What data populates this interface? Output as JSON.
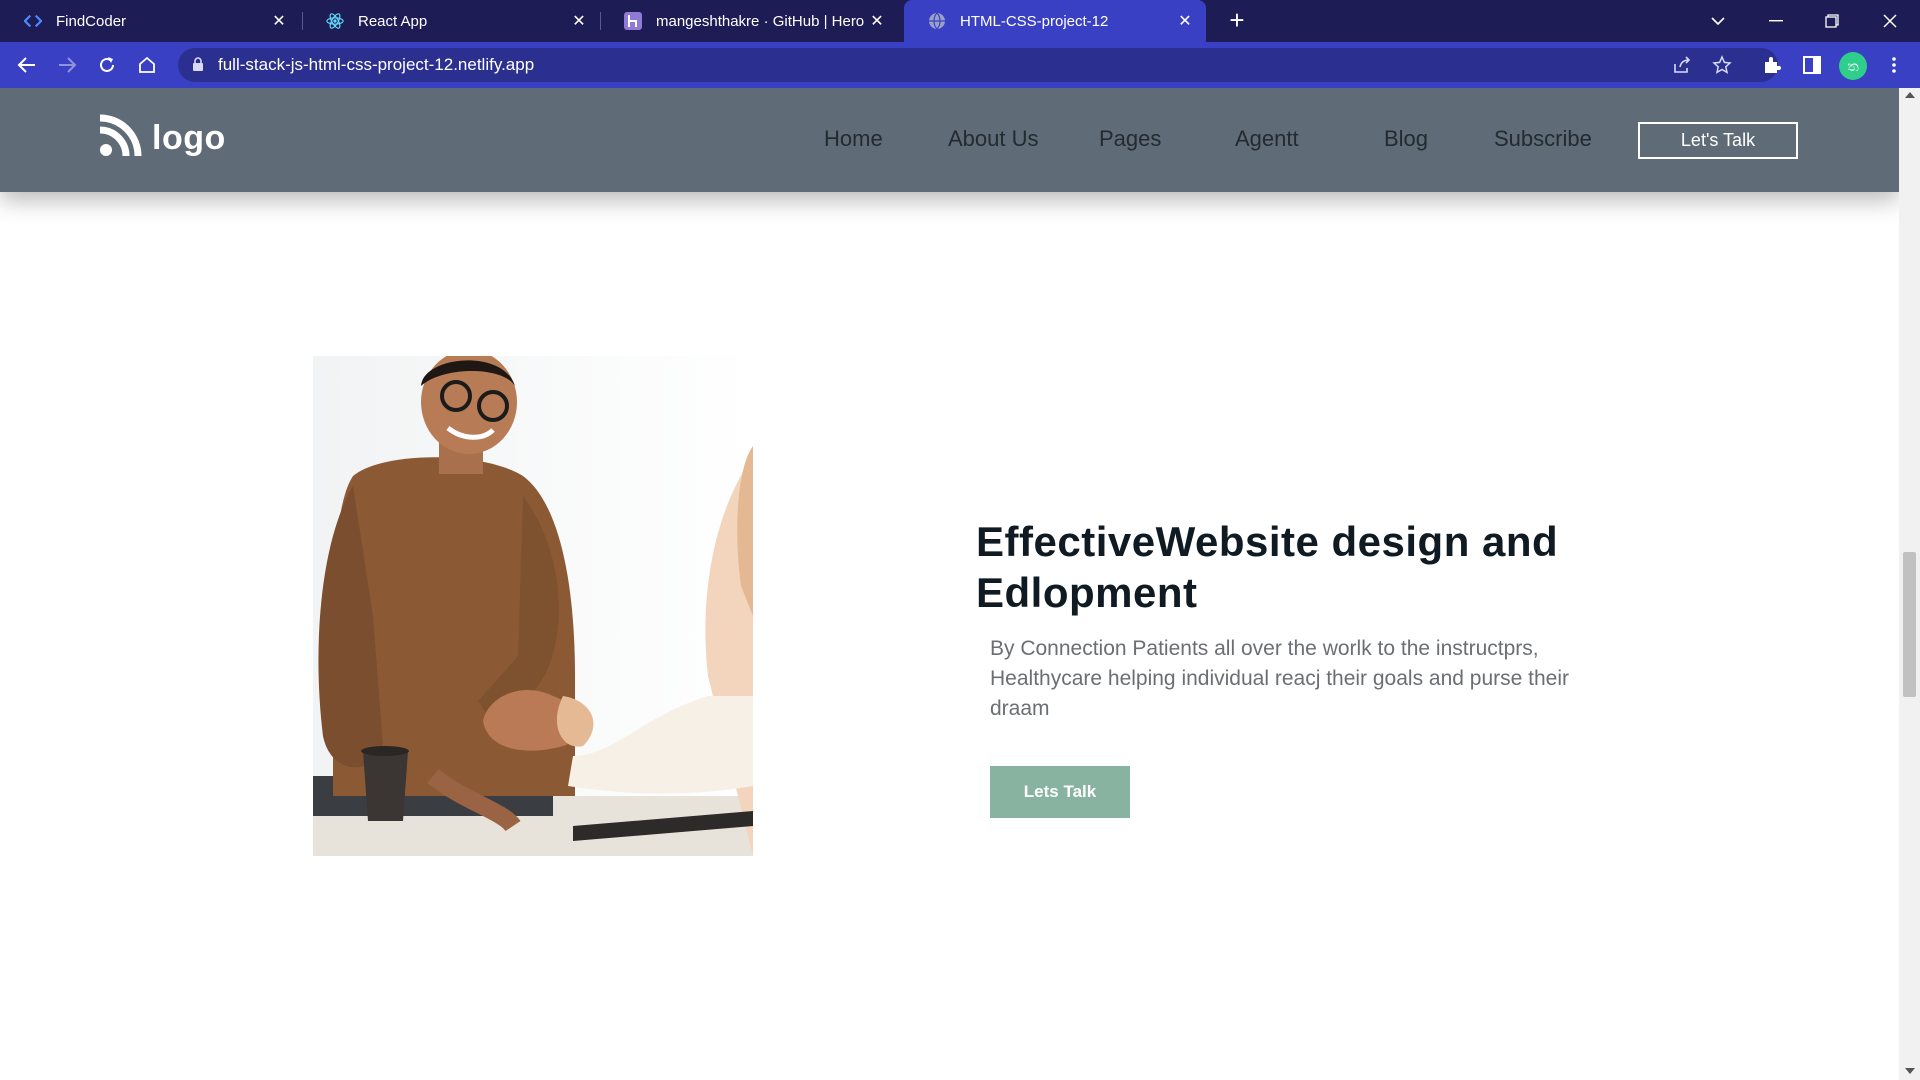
{
  "browser": {
    "tabs": [
      {
        "title": "FindCoder",
        "icon": "code-brackets-icon",
        "active": false
      },
      {
        "title": "React App",
        "icon": "react-icon",
        "active": false
      },
      {
        "title": "mangeshthakre · GitHub | Heroku",
        "icon": "heroku-icon",
        "active": false
      },
      {
        "title": "HTML-CSS-project-12",
        "icon": "globe-icon",
        "active": true
      }
    ],
    "url": "full-stack-js-html-css-project-12.netlify.app",
    "profile_initial": "ත"
  },
  "site": {
    "logo_text": "logo",
    "nav": [
      "Home",
      "About Us",
      "Pages",
      "Agentt",
      "Blog",
      "Subscribe"
    ],
    "cta_label": "Let's Talk"
  },
  "hero": {
    "title": "EffectiveWebsite design and Edlopment",
    "text": "By Connection Patients all over the worlk to the instructprs, Healthycare helping individual reacj their goals and purse their draam",
    "button_label": "Lets Talk"
  },
  "colors": {
    "tabstrip": "#1e1c55",
    "toolbar": "#3a40c4",
    "header": "#5f6b77",
    "accent_button": "#88b3a0"
  }
}
